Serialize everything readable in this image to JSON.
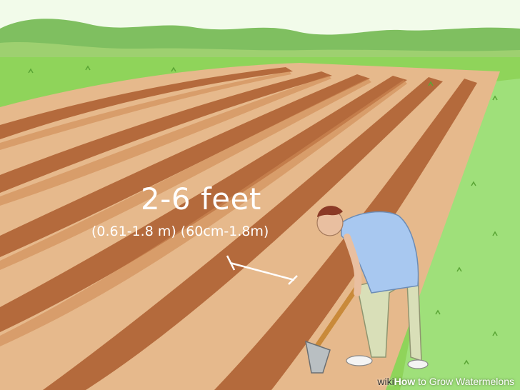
{
  "illustration": {
    "measurement_main": "2-6 feet",
    "measurement_sub": "(0.61-1.8 m) (60cm-1.8m)"
  },
  "watermark": {
    "brand_prefix": "wiki",
    "brand_suffix": "How",
    "title": " to Grow Watermelons"
  },
  "colors": {
    "sky": "#f2fbea",
    "hills": "#7fbf60",
    "grass": "#8fd45a",
    "soil": "#e6b98c",
    "furrow": "#b46a3c",
    "shirt": "#a8c8f0",
    "pants": "#d9dfb8"
  }
}
